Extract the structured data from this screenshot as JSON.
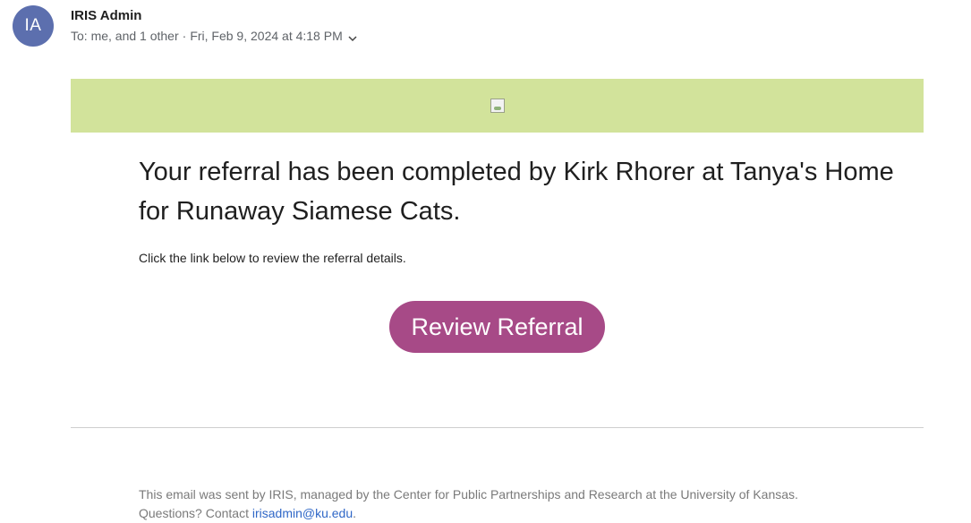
{
  "header": {
    "avatar_initials": "IA",
    "avatar_color": "#5c6fae",
    "sender_name": "IRIS Admin",
    "recipients": "To:  me, and 1 other",
    "separator": "·",
    "date": "Fri, Feb 9, 2024 at 4:18 PM"
  },
  "banner": {
    "background_color": "#d2e39b",
    "image_icon": "broken-image-icon"
  },
  "body": {
    "headline": "Your referral has been completed by Kirk Rhorer at Tanya's Home for Runaway Siamese Cats.",
    "instruction": "Click the link below to review the referral details.",
    "button_label": "Review Referral",
    "button_color": "#a74a87"
  },
  "footer": {
    "line1": "This email was sent by IRIS, managed by the Center for Public Partnerships and Research at the University of Kansas.",
    "line2_prefix": "Questions? Contact ",
    "email_link": "irisadmin@ku.edu",
    "line2_suffix": "."
  }
}
